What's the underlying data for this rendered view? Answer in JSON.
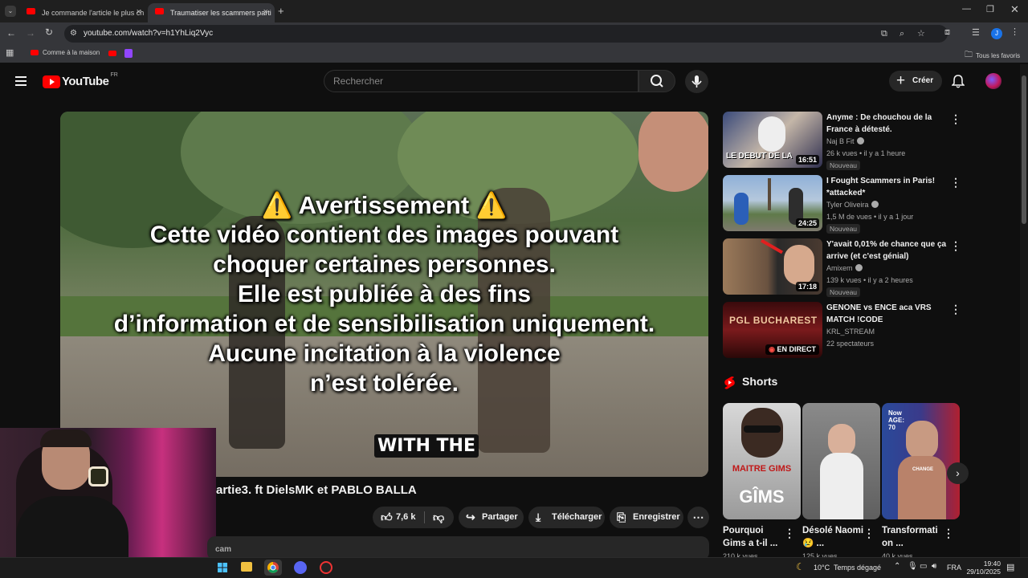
{
  "browser": {
    "tabs": [
      {
        "label": "Je commande l'article le plus ch"
      },
      {
        "label": "Traumatiser les scammers parti"
      }
    ],
    "url": "youtube.com/watch?v=h1YhLiq2Vyc",
    "profile_initial": "J",
    "bookmarks": [
      {
        "label": "Comme à la maison"
      }
    ],
    "all_bookmarks_label": "Tous les favoris"
  },
  "youtube": {
    "logo_text": "YouTube",
    "country_code": "FR",
    "search_placeholder": "Rechercher",
    "create_label": "Créer"
  },
  "video": {
    "overlay_warning": {
      "title": "⚠️ Avertissement ⚠️",
      "lines": [
        "Cette vidéo contient des images pouvant",
        "choquer certaines personnes.",
        "Elle est publiée à des fins",
        "d’information et de sensibilisation uniquement.",
        "Aucune incitation à la violence",
        "n’est tolérée."
      ]
    },
    "caption": "WITH THE",
    "title_visible": "artie3. ft DielsMK et PABLO BALLA",
    "likes": "7,6 k",
    "share_label": "Partager",
    "download_label": "Télécharger",
    "save_label": "Enregistrer",
    "description_snippet": "cam"
  },
  "recommendations": [
    {
      "title": "Anyme : De chouchou de la France à détesté.",
      "channel": "Naj B Fit",
      "verified": true,
      "meta": "26 k vues • il y a 1 heure",
      "badge": "Nouveau",
      "duration": "16:51",
      "thumb_text": "LE DEBUT DE LA"
    },
    {
      "title": "I Fought Scammers in Paris! *attacked*",
      "channel": "Tyler Oliveira",
      "verified": true,
      "meta": "1,5 M de vues • il y a 1 jour",
      "badge": "Nouveau",
      "duration": "24:25"
    },
    {
      "title": "Y'avait 0,01% de chance que ça arrive (et c'est génial)",
      "channel": "Amixem",
      "verified": true,
      "meta": "139 k vues • il y a 2 heures",
      "badge": "Nouveau",
      "duration": "17:18"
    },
    {
      "title": "GENONE vs ENCE aca VRS MATCH !CODE",
      "channel": "KRL_STREAM",
      "verified": false,
      "meta": "22 spectateurs",
      "live_label": "EN DIRECT",
      "thumb_text": "PGL BUCHAREST"
    }
  ],
  "shorts": {
    "heading": "Shorts",
    "items": [
      {
        "title": "Pourquoi Gims a t-il ...",
        "thumb_text": "GÎMS",
        "thumb_text2": "MAITRE GIMS",
        "views": "210 k vues"
      },
      {
        "title": "Désolé Naomi😢 ...",
        "views": "125 k vues"
      },
      {
        "title": "Transformati on ...",
        "thumb_text": "Now AGE: 70",
        "thumb_text2": "CHANGE",
        "views": "40 k vues"
      }
    ]
  },
  "taskbar": {
    "weather": "10°C",
    "weather_text": "Temps dégagé",
    "language": "FRA",
    "time": "19:40",
    "date": "29/10/2025"
  },
  "colors": {
    "youtube_red": "#ff0000",
    "background": "#0f0f0f",
    "chip": "#272727"
  }
}
